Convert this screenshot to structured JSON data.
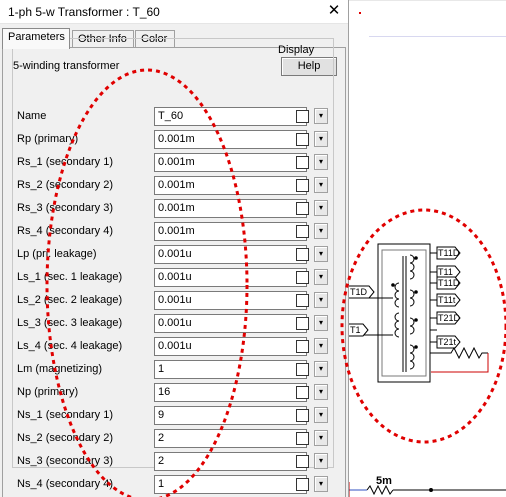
{
  "dialog": {
    "title": "1-ph 5-w Transformer : T_60",
    "close_glyph": "✕",
    "tabs": [
      {
        "label": "Parameters",
        "active": true
      },
      {
        "label": "Other Info",
        "active": false
      },
      {
        "label": "Color",
        "active": false
      }
    ],
    "heading": "5-winding transformer",
    "help_label": "Help",
    "display_header": "Display",
    "params": [
      {
        "label": "Name",
        "value": "T_60"
      },
      {
        "label": "Rp (primary)",
        "value": "0.001m"
      },
      {
        "label": "Rs_1 (secondary 1)",
        "value": "0.001m"
      },
      {
        "label": "Rs_2 (secondary 2)",
        "value": "0.001m"
      },
      {
        "label": "Rs_3 (secondary 3)",
        "value": "0.001m"
      },
      {
        "label": "Rs_4 (secondary 4)",
        "value": "0.001m"
      },
      {
        "label": "Lp (pri. leakage)",
        "value": "0.001u"
      },
      {
        "label": "Ls_1 (sec. 1 leakage)",
        "value": "0.001u"
      },
      {
        "label": "Ls_2 (sec. 2 leakage)",
        "value": "0.001u"
      },
      {
        "label": "Ls_3 (sec. 3 leakage)",
        "value": "0.001u"
      },
      {
        "label": "Ls_4 (sec. 4 leakage)",
        "value": "0.001u"
      },
      {
        "label": "Lm (magnetizing)",
        "value": "1"
      },
      {
        "label": "Np (primary)",
        "value": "16"
      },
      {
        "label": "Ns_1 (secondary 1)",
        "value": "9"
      },
      {
        "label": "Ns_2 (secondary 2)",
        "value": "2"
      },
      {
        "label": "Ns_3 (secondary 3)",
        "value": "2"
      },
      {
        "label": "Ns_4 (secondary 4)",
        "value": "1"
      }
    ]
  },
  "schematic": {
    "ports_left": [
      "T1D",
      "T1"
    ],
    "ports_right": [
      "T11D",
      "T11",
      "T11D",
      "T11t",
      "T21D",
      "T21t"
    ],
    "resistor_label": "5m",
    "colors": {
      "annotation": "#e00000",
      "wire_red": "#cc0000",
      "wire_blue": "#3050c0",
      "component": "#000000"
    }
  },
  "icons": {
    "close": "close-icon",
    "dropdown": "chevron-down-icon"
  }
}
